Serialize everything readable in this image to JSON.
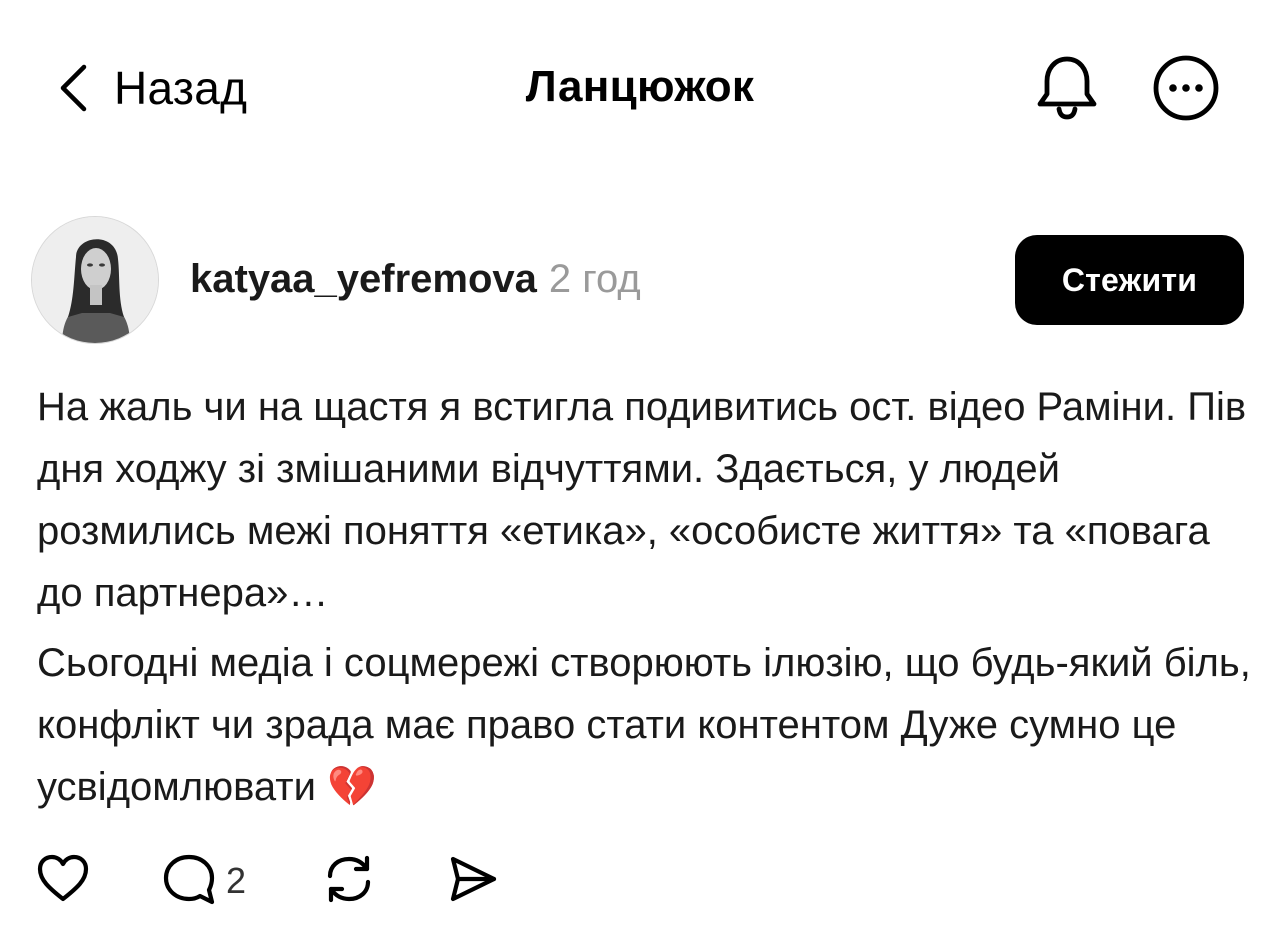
{
  "header": {
    "back_label": "Назад",
    "title": "Ланцюжок",
    "icons": {
      "back": "chevron-left-icon",
      "notifications": "bell-icon",
      "more": "more-horizontal-icon"
    }
  },
  "post": {
    "username": "katyaa_yefremova",
    "time": "2 год",
    "follow_label": "Стежити",
    "paragraphs": [
      "На жаль чи на щастя я встигла подивитись ост. відео Раміни. Пів дня ходжу зі змішаними відчуттями. Здається, у людей розмились межі поняття «етика», «особисте життя» та «повага до партнера»…",
      "Сьогодні медіа і соцмережі створюють ілюзію, що будь-який біль, конфлікт чи зрада має право стати контентом Дуже сумно це усвідомлювати 💔"
    ],
    "actions": {
      "like_icon": "heart-icon",
      "comment_icon": "comment-icon",
      "comment_count": "2",
      "repost_icon": "repost-icon",
      "share_icon": "send-icon"
    }
  },
  "colors": {
    "text": "#000000",
    "muted": "#9a9a9a",
    "button_bg": "#000000",
    "button_text": "#ffffff"
  }
}
